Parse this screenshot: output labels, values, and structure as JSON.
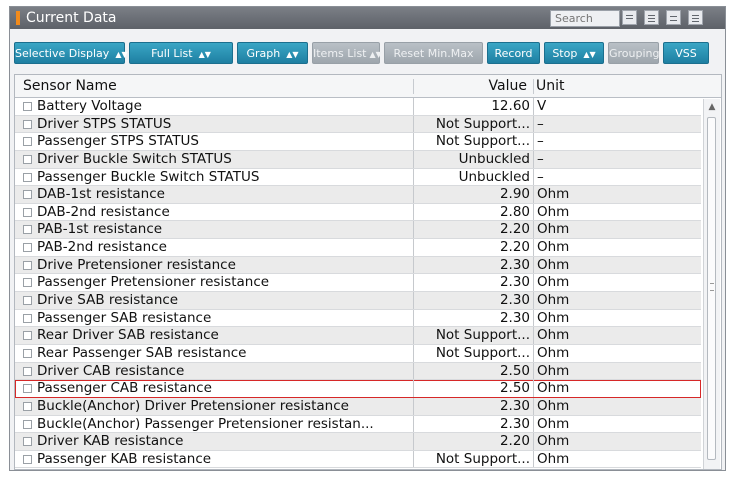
{
  "window": {
    "title": "Current Data"
  },
  "search": {
    "placeholder": "Search"
  },
  "toolbar": {
    "selective_display": "Selective Display",
    "full_list": "Full List",
    "graph": "Graph",
    "items_list": "Items List",
    "reset_min_max": "Reset Min.Max",
    "record": "Record",
    "stop": "Stop",
    "grouping": "Grouping",
    "vss": "VSS"
  },
  "table": {
    "headers": {
      "name": "Sensor Name",
      "value": "Value",
      "unit": "Unit"
    },
    "rows": [
      {
        "name": "Battery Voltage",
        "value": "12.60",
        "unit": "V"
      },
      {
        "name": "Driver STPS STATUS",
        "value": "Not Support...",
        "unit": "–"
      },
      {
        "name": "Passenger STPS STATUS",
        "value": "Not Support...",
        "unit": "–"
      },
      {
        "name": "Driver Buckle Switch STATUS",
        "value": "Unbuckled",
        "unit": "–"
      },
      {
        "name": "Passenger Buckle Switch STATUS",
        "value": "Unbuckled",
        "unit": "–"
      },
      {
        "name": "DAB-1st resistance",
        "value": "2.90",
        "unit": "Ohm"
      },
      {
        "name": "DAB-2nd resistance",
        "value": "2.80",
        "unit": "Ohm"
      },
      {
        "name": "PAB-1st resistance",
        "value": "2.20",
        "unit": "Ohm"
      },
      {
        "name": "PAB-2nd resistance",
        "value": "2.20",
        "unit": "Ohm"
      },
      {
        "name": "Drive Pretensioner resistance",
        "value": "2.30",
        "unit": "Ohm"
      },
      {
        "name": "Passenger Pretensioner resistance",
        "value": "2.30",
        "unit": "Ohm"
      },
      {
        "name": "Drive SAB resistance",
        "value": "2.30",
        "unit": "Ohm"
      },
      {
        "name": "Passenger SAB resistance",
        "value": "2.30",
        "unit": "Ohm"
      },
      {
        "name": "Rear Driver SAB resistance",
        "value": "Not Support...",
        "unit": "Ohm"
      },
      {
        "name": "Rear Passenger SAB resistance",
        "value": "Not Support...",
        "unit": "Ohm"
      },
      {
        "name": "Driver CAB resistance",
        "value": "2.50",
        "unit": "Ohm"
      },
      {
        "name": "Passenger CAB resistance",
        "value": "2.50",
        "unit": "Ohm"
      },
      {
        "name": "Buckle(Anchor) Driver Pretensioner resistance",
        "value": "2.30",
        "unit": "Ohm"
      },
      {
        "name": "Buckle(Anchor) Passenger Pretensioner resistan...",
        "value": "2.30",
        "unit": "Ohm"
      },
      {
        "name": "Driver KAB resistance",
        "value": "2.20",
        "unit": "Ohm"
      },
      {
        "name": "Passenger KAB resistance",
        "value": "Not Support...",
        "unit": "Ohm"
      }
    ],
    "highlighted_row": "Passenger CAB resistance"
  },
  "colors": {
    "accent": "#2591b5",
    "highlight": "#d62828",
    "title_marker": "#f28b1c"
  }
}
